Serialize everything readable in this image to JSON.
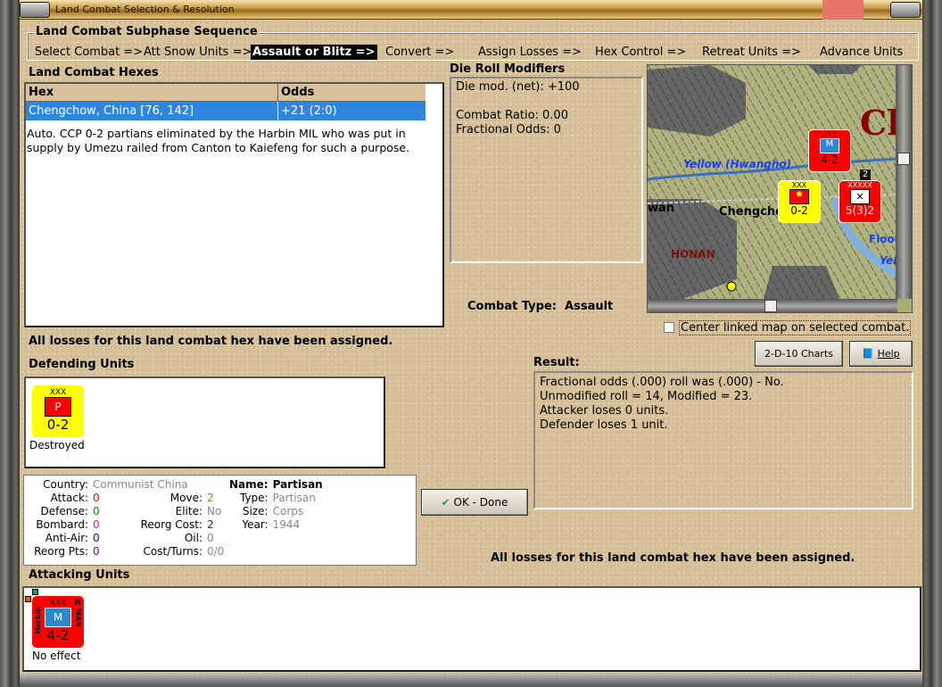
{
  "window": {
    "title": "Land Combat Selection & Resolution"
  },
  "subphase": {
    "title": "Land Combat Subphase Sequence",
    "steps": [
      "Select Combat =>",
      "Att Snow Units =>",
      "Assault or Blitz =>",
      "Convert =>",
      "Assign Losses =>",
      "Hex Control =>",
      "Retreat Units =>",
      "Advance Units"
    ],
    "active_index": 2
  },
  "hexes": {
    "title": "Land Combat Hexes",
    "columns": [
      "Hex",
      "Odds"
    ],
    "rows": [
      {
        "hex": "Chengchow, China [76, 142]",
        "odds": "+21 (2:0)"
      }
    ],
    "note": "Auto.  CCP 0-2 partians eliminated by the Harbin MIL who was put in supply by Umezu railed from Canton to Kaiefeng for such a purpose."
  },
  "modifiers": {
    "title": "Die Roll Modifiers",
    "lines": [
      "Die mod. (net): +100",
      "",
      "Combat Ratio: 0.00",
      "Fractional Odds: 0"
    ]
  },
  "combat_type": {
    "label": "Combat Type:",
    "value": "Assault"
  },
  "map": {
    "labels": [
      "Yellow (Hwangho)",
      "Chengchow",
      "HONAN",
      "Flood",
      "Yel",
      "Ch",
      "wan"
    ],
    "units": [
      {
        "strength": "4-2",
        "size": "XXX"
      },
      {
        "strength": "0-2",
        "size": "XXX"
      },
      {
        "strength": "5(3)2",
        "size": "XXXXX"
      }
    ],
    "stack_count": "2"
  },
  "center_map": {
    "label": "Center linked map on selected combat.",
    "checked": false
  },
  "losses_msg": "All losses for this land combat hex have been assigned.",
  "buttons": {
    "charts": "2-D-10 Charts",
    "help": "Help",
    "ok": "OK - Done"
  },
  "defending": {
    "title": "Defending Units",
    "units": [
      {
        "size": "XXX",
        "symbol": "P",
        "strength": "0-2",
        "status": "Destroyed"
      }
    ]
  },
  "info": {
    "country_k": "Country:",
    "country": "Communist China",
    "attack_k": "Attack:",
    "attack": "0",
    "defense_k": "Defense:",
    "defense": "0",
    "bombard_k": "Bombard:",
    "bombard": "0",
    "antiair_k": "Anti-Air:",
    "antiair": "0",
    "reorgpts_k": "Reorg Pts:",
    "reorgpts": "0",
    "move_k": "Move:",
    "move": "2",
    "elite_k": "Elite:",
    "elite": "No",
    "reorgcost_k": "Reorg Cost:",
    "reorgcost": "2",
    "oil_k": "Oil:",
    "oil": "0",
    "costturns_k": "Cost/Turns:",
    "costturns": "0/0",
    "name_k": "Name:",
    "name": "Partisan",
    "type_k": "Type:",
    "type": "Partisan",
    "size_k": "Size:",
    "size": "Corps",
    "year_k": "Year:",
    "year": "1944"
  },
  "result": {
    "title": "Result:",
    "lines": [
      "Fractional odds (.000) roll was (.000)  - No.",
      "Unmodified roll = 14, Modified = 23.",
      "Attacker loses 0 units.",
      "Defender loses 1 unit."
    ]
  },
  "attacking": {
    "title": "Attacking Units",
    "units": [
      {
        "size": "XXX",
        "symbol": "M",
        "left": "Harbin",
        "right": "MAN",
        "corner": "R",
        "strength": "4-2",
        "status": "No effect"
      }
    ]
  },
  "colors": {
    "selected_row": "#2f86de",
    "attack": "#ff0000",
    "defense": "#008000",
    "bombard": "#ff00ff",
    "antiair": "#0000ff",
    "reorg": "#800080",
    "grey": "#888888",
    "unit_red": "#ff0000",
    "partisan_yellow": "#ffff00"
  }
}
